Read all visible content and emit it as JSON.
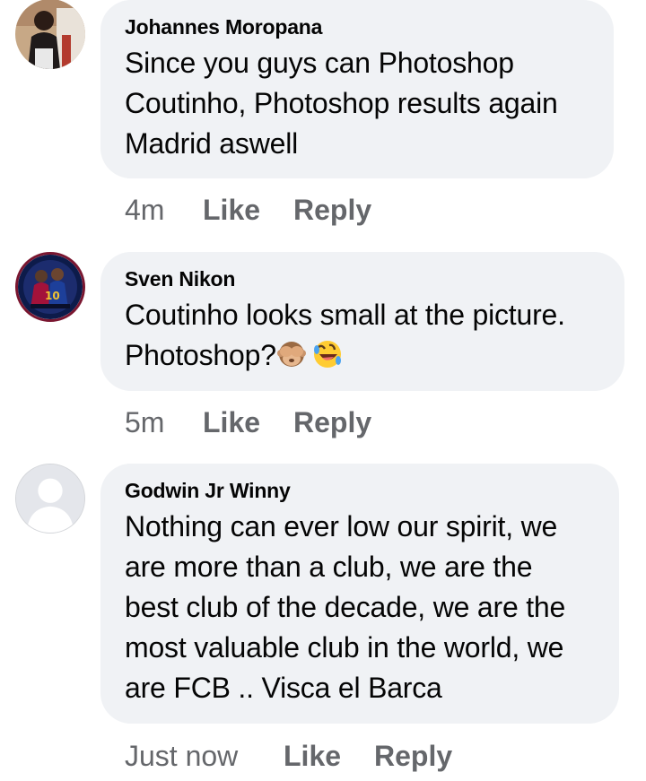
{
  "comments": [
    {
      "author": "Johannes Moropana",
      "text": "Since you guys can Photoshop\nCoutinho, Photoshop results again\nMadrid aswell",
      "time": "4m",
      "like_label": "Like",
      "reply_label": "Reply",
      "avatar_icon": "profile-photo-icon"
    },
    {
      "author": "Sven Nikon",
      "text": "Coutinho looks small at the picture.\nPhotoshop?",
      "emojis": [
        "see-no-evil-monkey-emoji",
        "rolling-on-floor-laughing-emoji"
      ],
      "time": "5m",
      "like_label": "Like",
      "reply_label": "Reply",
      "avatar_icon": "profile-photo-icon"
    },
    {
      "author": "Godwin Jr Winny",
      "text": "Nothing can ever low our spirit, we\nare more than a club, we are the\nbest club of the decade, we are the\nmost valuable club in the world, we\nare FCB .. Visca el Barca",
      "time": "Just now",
      "like_label": "Like",
      "reply_label": "Reply",
      "avatar_icon": "default-avatar-icon"
    }
  ],
  "colors": {
    "bubble_bg": "#f0f2f5",
    "text": "#050505",
    "meta": "#65676b"
  }
}
